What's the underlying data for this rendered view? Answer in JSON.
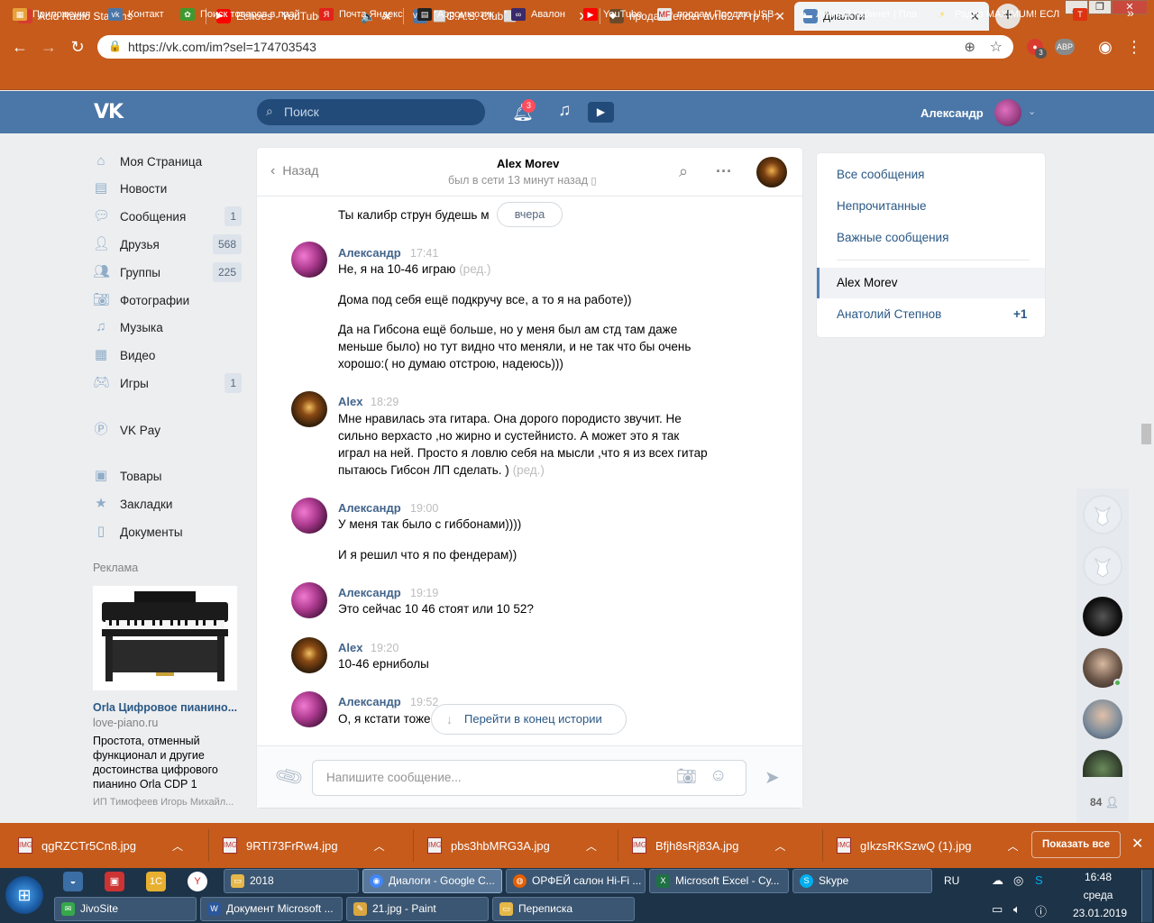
{
  "browser": {
    "tabs": [
      {
        "title": "Acid Radio Stations",
        "icon": "acid-radio-icon",
        "color": "#d63b2f"
      },
      {
        "title": "Echoes - YouTube",
        "icon": "youtube-icon",
        "color": "#ff0000"
      },
      {
        "title": "G.A.S. Club",
        "icon": "vk-icon",
        "color": "#4a76a8"
      },
      {
        "title": "продам fender avri62 77тр про",
        "icon": "ads-icon",
        "color": "#6a4a2a"
      },
      {
        "title": "Диалоги",
        "icon": "vk-messages-icon",
        "color": "#5181b8"
      }
    ],
    "url": "https://vk.com/im?sel=174703543",
    "bookmarks": [
      "Приложения",
      "Контакт",
      "Поиск товаров в прай",
      "Почта Яндекс",
      "Аэромьюзик",
      "Авалон",
      "YouTube",
      "продам Продаю USB-",
      "Личный кабинет | Пла",
      "Радио MAXIMUM! ЕСЛ"
    ],
    "extension_badge": "3",
    "extension_label": "АВР"
  },
  "vk": {
    "search_placeholder": "Поиск",
    "notifications_count": "3",
    "user_name": "Александр",
    "menu": [
      {
        "label": "Моя Страница",
        "count": ""
      },
      {
        "label": "Новости",
        "count": ""
      },
      {
        "label": "Сообщения",
        "count": "1"
      },
      {
        "label": "Друзья",
        "count": "568"
      },
      {
        "label": "Группы",
        "count": "225"
      },
      {
        "label": "Фотографии",
        "count": ""
      },
      {
        "label": "Музыка",
        "count": ""
      },
      {
        "label": "Видео",
        "count": ""
      },
      {
        "label": "Игры",
        "count": "1"
      },
      {
        "label": "VK Pay",
        "count": ""
      },
      {
        "label": "Товары",
        "count": ""
      },
      {
        "label": "Закладки",
        "count": ""
      },
      {
        "label": "Документы",
        "count": ""
      }
    ],
    "ad": {
      "label": "Реклама",
      "title": "Orla Цифровое пианино...",
      "site": "love-piano.ru",
      "description": "Простота, отменный функционал и другие достоинства цифрового пианино Orla CDP 1",
      "footer": "ИП Тимофеев Игорь Михайл..."
    }
  },
  "chat": {
    "back_label": "Назад",
    "peer_name": "Alex Morev",
    "peer_status": "был в сети 13 минут назад",
    "date_pill": "вчера",
    "partial_message": "Ты калибр струн будешь м",
    "messages": [
      {
        "author": "Александр",
        "time": "17:41",
        "lines": [
          "Не, я на 10-46 играю",
          "Дома под себя ещё подкручу все, а то я на работе))",
          "Да на Гибсона ещё больше, но у меня был ам стд там даже меньше было) но тут видно что меняли, и не так что бы очень хорошо:( но думаю отстрою, надеюсь)))"
        ],
        "edited": "(ред.)"
      },
      {
        "author": "Alex",
        "time": "18:29",
        "lines": [
          "Мне нравилась эта гитара. Она дорого породисто звучит. Не сильно верхасто ,но жирно и сустейнисто. А может это я так играл на ней. Просто я ловлю себя на мысли ,что я из всех гитар пытаюсь Гибсон ЛП сделать. )"
        ],
        "edited": "(ред.)"
      },
      {
        "author": "Александр",
        "time": "19:00",
        "lines": [
          "У меня так было с гиббонами))))",
          "И я решил что я по фендерам))"
        ],
        "edited": ""
      },
      {
        "author": "Александр",
        "time": "19:19",
        "lines": [
          "Это сейчас 10 46 стоят или 10 52?"
        ],
        "edited": ""
      },
      {
        "author": "Alex",
        "time": "19:20",
        "lines": [
          "10-46 ерниболы"
        ],
        "edited": ""
      },
      {
        "author": "Александр",
        "time": "19:52",
        "lines": [
          "О, я кстати тоже"
        ],
        "edited": ""
      }
    ],
    "goto_end": "Перейти в конец истории",
    "input_placeholder": "Напишите сообщение..."
  },
  "right_nav": {
    "items": [
      "Все сообщения",
      "Непрочитанные",
      "Важные сообщения"
    ],
    "dialogs": [
      {
        "name": "Alex Morev",
        "badge": "",
        "selected": true
      },
      {
        "name": "Анатолий Степнов",
        "badge": "+1",
        "selected": false
      }
    ]
  },
  "friends_bar": {
    "count": "84"
  },
  "downloads": {
    "files": [
      "qgRZCTr5Cn8.jpg",
      "9RTI73FrRw4.jpg",
      "pbs3hbMRG3A.jpg",
      "Bfjh8sRj83A.jpg",
      "gIkzsRKSzwQ (1).jpg"
    ],
    "show_all": "Показать все"
  },
  "taskbar": {
    "top_row": [
      {
        "label": "2018",
        "icon": "folder-icon",
        "color": "#e6b84a"
      },
      {
        "label": "Диалоги - Google C...",
        "icon": "chrome-icon",
        "color": "#4285f4"
      },
      {
        "label": "ОРФЕЙ салон Hi-Fi ...",
        "icon": "firefox-icon",
        "color": "#e66000"
      },
      {
        "label": "Microsoft Excel - Су...",
        "icon": "excel-icon",
        "color": "#1e7145"
      },
      {
        "label": "Skype",
        "icon": "skype-icon",
        "color": "#00aff0"
      }
    ],
    "bottom_row": [
      {
        "label": "JivoSite",
        "icon": "jivosite-icon",
        "color": "#36a84b"
      },
      {
        "label": "Документ Microsoft ...",
        "icon": "word-icon",
        "color": "#2b579a"
      },
      {
        "label": "21.jpg - Paint",
        "icon": "paint-icon",
        "color": "#d9a640"
      },
      {
        "label": "Переписка",
        "icon": "folder-icon",
        "color": "#e6b84a"
      }
    ],
    "lang": "RU",
    "time": "16:48",
    "weekday": "среда",
    "date": "23.01.2019"
  },
  "colors": {
    "vk_blue": "#4a76a8",
    "chrome_frame": "#c65b1c",
    "link": "#2a5885"
  }
}
